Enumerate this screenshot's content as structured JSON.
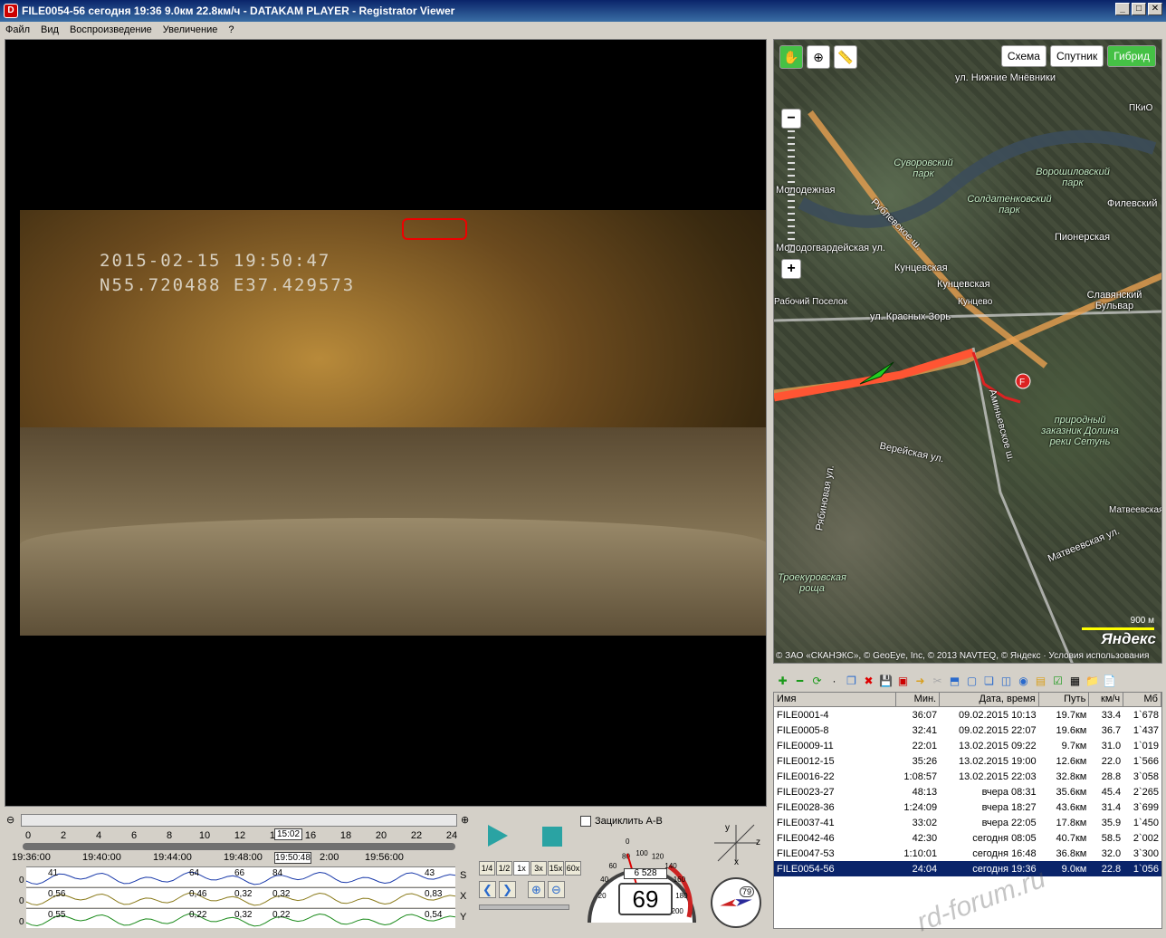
{
  "window": {
    "title": "FILE0054-56   сегодня 19:36   9.0км   22.8км/ч  -  DATAKAM PLAYER - Registrator Viewer",
    "min": "_",
    "max": "□",
    "close": "✕"
  },
  "menu": [
    "Файл",
    "Вид",
    "Воспроизведение",
    "Увеличение",
    "?"
  ],
  "video": {
    "osd_datetime": "2015-02-15  19:50:47",
    "osd_coords": "N55.720488  E37.429573"
  },
  "map": {
    "buttons": [
      "Схема",
      "Спутник",
      "Гибрид"
    ],
    "active_button": "Гибрид",
    "labels": {
      "l1": "ул. Нижние Мнёвники",
      "l2": "Суворовский парк",
      "l3": "Ворошиловский парк",
      "l4": "Солдатенковский парк",
      "l5": "Молодежная",
      "l6": "Рублевское ш.",
      "l7": "Пионерская",
      "l8": "Филевский",
      "l9": "Молодогвардейская ул.",
      "l10": "Кунцевская",
      "l11": "Кунцевская",
      "l12": "Кунцево",
      "l13": "Славянский Бульвар",
      "l14": "ул. Красных Зорь",
      "l15": "Рабочий Поселок",
      "l16": "Аминьевское ш.",
      "l17": "природный заказник Долина реки Сетунь",
      "l18": "Верейская ул.",
      "l19": "Рябиновая ул.",
      "l20": "Матвеевская",
      "l21": "Матвеевская ул.",
      "l22": "Троекуровская роща",
      "l23": "ПКиО"
    },
    "scale": "900 м",
    "logo": "Яндекс",
    "copyright": "© ЗАО «СКАНЭКС», © GeoEye, Inc, © 2013 NAVTEQ, © Яндекс · Условия использования"
  },
  "table": {
    "headers": [
      "Имя",
      "Мин.",
      "Дата, время",
      "Путь",
      "км/ч",
      "Мб"
    ],
    "rows": [
      [
        "FILE0001-4",
        "36:07",
        "09.02.2015 10:13",
        "19.7км",
        "33.4",
        "1`678"
      ],
      [
        "FILE0005-8",
        "32:41",
        "09.02.2015 22:07",
        "19.6км",
        "36.7",
        "1`437"
      ],
      [
        "FILE0009-11",
        "22:01",
        "13.02.2015 09:22",
        "9.7км",
        "31.0",
        "1`019"
      ],
      [
        "FILE0012-15",
        "35:26",
        "13.02.2015 19:00",
        "12.6км",
        "22.0",
        "1`566"
      ],
      [
        "FILE0016-22",
        "1:08:57",
        "13.02.2015 22:03",
        "32.8км",
        "28.8",
        "3`058"
      ],
      [
        "FILE0023-27",
        "48:13",
        "вчера 08:31",
        "35.6км",
        "45.4",
        "2`265"
      ],
      [
        "FILE0028-36",
        "1:24:09",
        "вчера 18:27",
        "43.6км",
        "31.4",
        "3`699"
      ],
      [
        "FILE0037-41",
        "33:02",
        "вчера 22:05",
        "17.8км",
        "35.9",
        "1`450"
      ],
      [
        "FILE0042-46",
        "42:30",
        "сегодня 08:05",
        "40.7км",
        "58.5",
        "2`002"
      ],
      [
        "FILE0047-53",
        "1:10:01",
        "сегодня 16:48",
        "36.8км",
        "32.0",
        "3`300"
      ],
      [
        "FILE0054-56",
        "24:04",
        "сегодня 19:36",
        "9.0км",
        "22.8",
        "1`056"
      ]
    ]
  },
  "timeline": {
    "ticks": [
      "0",
      "2",
      "4",
      "6",
      "8",
      "10",
      "12",
      "14",
      "16",
      "18",
      "20",
      "22",
      "24"
    ],
    "current": "15:02",
    "times": [
      "19:36:00",
      "19:40:00",
      "19:44:00",
      "19:48:00",
      "19:50:48",
      "2:00",
      "19:56:00"
    ],
    "graph1": [
      "41",
      "64",
      "66",
      "84",
      "43"
    ],
    "graph2": [
      "0,56",
      "0,46",
      "0,32",
      "0,32",
      "0,83"
    ],
    "graph3": [
      "0,55",
      "0,22",
      "0,32",
      "0,22",
      "0,54"
    ],
    "axis_labels": [
      "S",
      "X",
      "Y"
    ],
    "zero": "0"
  },
  "controls": {
    "loop_label": "Зациклить А-В",
    "speeds": [
      "1/4",
      "1/2",
      "1x",
      "3x",
      "15x",
      "60x"
    ],
    "active_speed": "1x",
    "speed_value": "69",
    "odometer": "6 528",
    "gauge_ticks": [
      "20",
      "40",
      "60",
      "80",
      "100",
      "120",
      "140",
      "160",
      "180",
      "200"
    ],
    "gauge_zero": "0",
    "compass_value": "79",
    "axis_letters": [
      "y",
      "z",
      "x"
    ]
  },
  "watermark": "rd-forum.ru",
  "colors": {
    "accent": "#2aa3a3",
    "selected_row": "#0a246a",
    "map_active": "#45c145",
    "track": "#ff5533"
  }
}
